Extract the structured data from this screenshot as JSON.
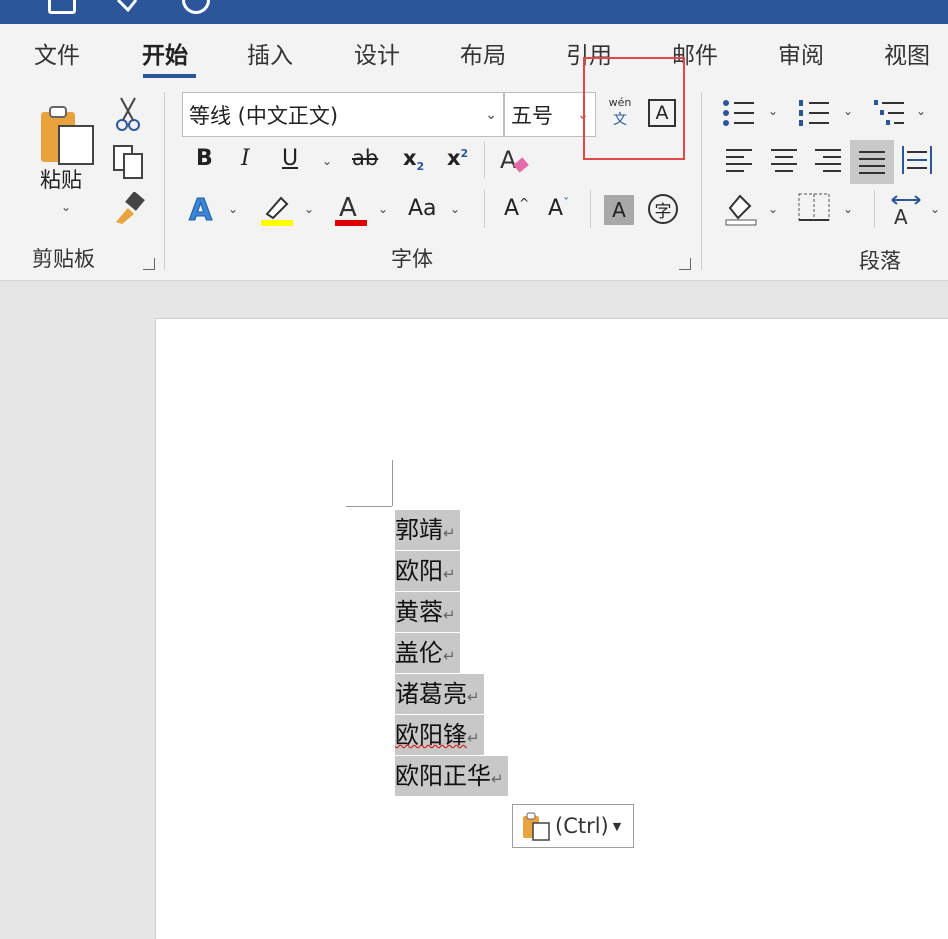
{
  "tabs": [
    "文件",
    "开始",
    "插入",
    "设计",
    "布局",
    "引用",
    "邮件",
    "审阅",
    "视图"
  ],
  "clipboard": {
    "paste_label": "粘贴",
    "group_label": "剪贴板"
  },
  "font": {
    "font_name": "等线 (中文正文)",
    "font_size": "五号",
    "group_label": "字体",
    "bold": "B",
    "italic": "I",
    "underline": "U",
    "strike": "ab",
    "subscript": "x",
    "superscript": "x",
    "text_effect": "A",
    "change_case": "Aa",
    "grow": "A",
    "shrink": "A",
    "char_shading": "A",
    "enclose": "字",
    "phonetic_top": "wén",
    "phonetic_bottom": "文",
    "char_border": "A"
  },
  "paragraph": {
    "group_label": "段落"
  },
  "document": {
    "lines": [
      "郭靖",
      "欧阳",
      "黄蓉",
      "盖伦",
      "诸葛亮",
      "欧阳锋",
      "欧阳正华"
    ],
    "paragraph_mark": "↵"
  },
  "paste_options": {
    "label": "(Ctrl)"
  },
  "colors": {
    "accent": "#2b579a",
    "highlight_yellow": "#ffff00",
    "font_red": "#e00000",
    "callout_red": "#e04848",
    "selection": "#c8c8c8"
  }
}
